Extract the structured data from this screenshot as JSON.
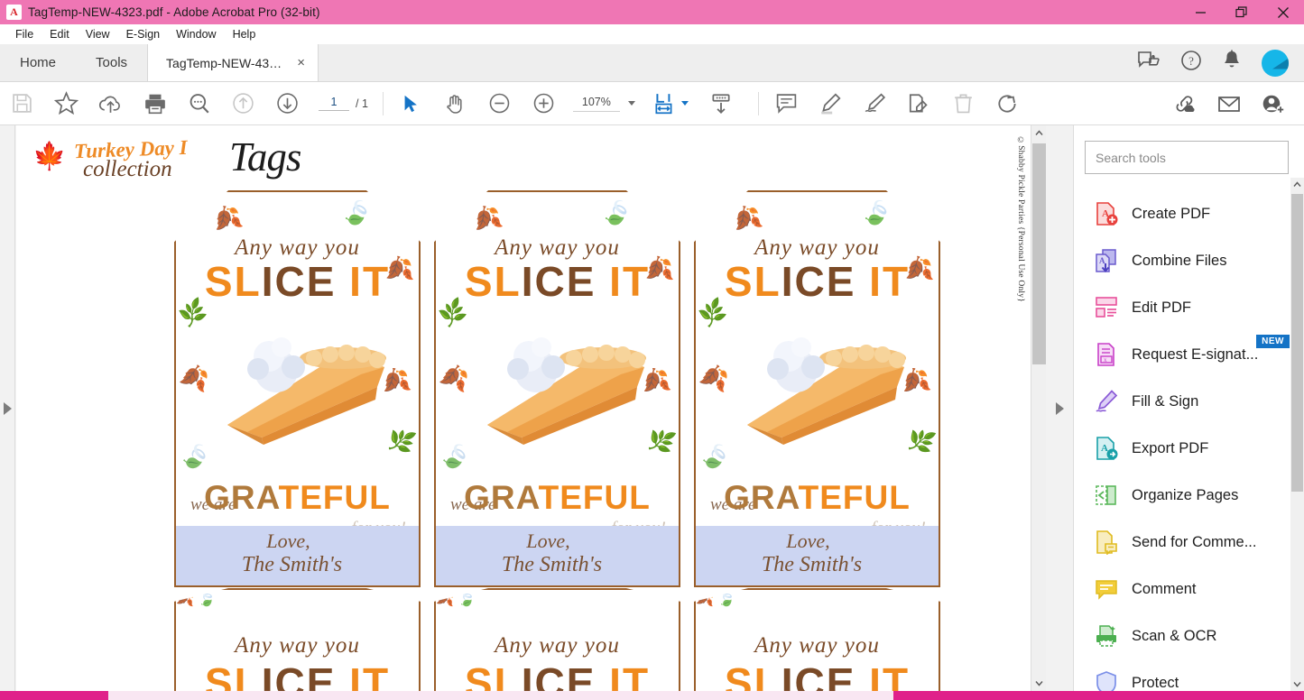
{
  "window": {
    "title": "TagTemp-NEW-4323.pdf - Adobe Acrobat Pro (32-bit)",
    "app_icon": "A",
    "titlebar_color": "#ef76b4",
    "controls": [
      {
        "name": "minimize",
        "glyph": "minimize-icon"
      },
      {
        "name": "restore",
        "glyph": "restore-icon"
      },
      {
        "name": "close",
        "glyph": "close-icon"
      }
    ]
  },
  "menubar": {
    "items": [
      {
        "label": "File"
      },
      {
        "label": "Edit"
      },
      {
        "label": "View"
      },
      {
        "label": "E-Sign"
      },
      {
        "label": "Window"
      },
      {
        "label": "Help"
      }
    ]
  },
  "tabstrip": {
    "nav": [
      {
        "label": "Home"
      },
      {
        "label": "Tools"
      }
    ],
    "document_tab": {
      "label": "TagTemp-NEW-432...",
      "close": "×"
    },
    "right_icons": [
      {
        "name": "feedback-icon"
      },
      {
        "name": "help-icon"
      },
      {
        "name": "notifications-bell-icon"
      },
      {
        "name": "account-avatar"
      }
    ]
  },
  "toolbar": {
    "icons_left": [
      {
        "name": "save-icon",
        "disabled": true
      },
      {
        "name": "star-icon",
        "disabled": false
      },
      {
        "name": "cloud-upload-icon",
        "disabled": false
      },
      {
        "name": "print-icon",
        "disabled": false
      },
      {
        "name": "search-icon",
        "disabled": false
      },
      {
        "name": "previous-page-icon",
        "disabled": true
      },
      {
        "name": "next-page-icon",
        "disabled": false
      }
    ],
    "page_current": "1",
    "page_total": "/ 1",
    "tools": [
      {
        "name": "select-tool-icon"
      },
      {
        "name": "hand-tool-icon"
      },
      {
        "name": "zoom-out-icon"
      },
      {
        "name": "zoom-in-icon"
      }
    ],
    "zoom_value": "107%",
    "fit_page_icon": "fit-page-icon",
    "scroll_mode_icon": "scroll-down-icon",
    "annotation_icons": [
      {
        "name": "comment-icon",
        "disabled": false
      },
      {
        "name": "highlight-icon",
        "disabled": false
      },
      {
        "name": "sign-icon",
        "disabled": false
      },
      {
        "name": "fill-sign-icon",
        "disabled": false
      },
      {
        "name": "delete-icon",
        "disabled": true
      },
      {
        "name": "rotate-icon",
        "disabled": false
      }
    ],
    "share_icons": [
      {
        "name": "share-link-icon"
      },
      {
        "name": "email-icon"
      },
      {
        "name": "add-person-icon"
      }
    ]
  },
  "document": {
    "header": {
      "logo_line1": "Turkey Day I",
      "logo_line2": "collection",
      "title": "Tags"
    },
    "copyright": "©Shabby Pickle Parties {Personal Use Only}",
    "tag": {
      "line_any": "Any way you",
      "line_slice_part1": "SL",
      "line_slice_part2": "ICE",
      "line_slice_part3": " IT",
      "line_we_are": "we are",
      "line_grateful_a": "GRA",
      "line_grateful_b": "TEFUL",
      "line_for_you": "for you!",
      "field_line1": "Love,",
      "field_line2": "The Smith's",
      "field_highlight_color": "#ccd5f2",
      "border_color": "#9a5f2b",
      "orange": "#f08a1d",
      "brown": "#7a4a27"
    },
    "tag_count_row1": 3,
    "tag_count_row2": 3
  },
  "tools_panel": {
    "search_placeholder": "Search tools",
    "items": [
      {
        "label": "Create PDF",
        "icon": "create-pdf-icon",
        "color": "#e8413d",
        "badge": ""
      },
      {
        "label": "Combine Files",
        "icon": "combine-files-icon",
        "color": "#6a5acd",
        "badge": ""
      },
      {
        "label": "Edit PDF",
        "icon": "edit-pdf-icon",
        "color": "#e8509b",
        "badge": ""
      },
      {
        "label": "Request E-signat...",
        "icon": "request-esignature-icon",
        "color": "#c840c8",
        "badge": "NEW"
      },
      {
        "label": "Fill & Sign",
        "icon": "fill-sign-icon",
        "color": "#8a5ad6",
        "badge": ""
      },
      {
        "label": "Export PDF",
        "icon": "export-pdf-icon",
        "color": "#18a0a8",
        "badge": ""
      },
      {
        "label": "Organize Pages",
        "icon": "organize-pages-icon",
        "color": "#5cb85c",
        "badge": ""
      },
      {
        "label": "Send for Comme...",
        "icon": "send-for-comments-icon",
        "color": "#e0bb20",
        "badge": ""
      },
      {
        "label": "Comment",
        "icon": "comment-icon",
        "color": "#e0bb20",
        "badge": ""
      },
      {
        "label": "Scan & OCR",
        "icon": "scan-ocr-icon",
        "color": "#4caf50",
        "badge": ""
      },
      {
        "label": "Protect",
        "icon": "protect-icon",
        "color": "#7b8fe8",
        "badge": ""
      }
    ]
  }
}
